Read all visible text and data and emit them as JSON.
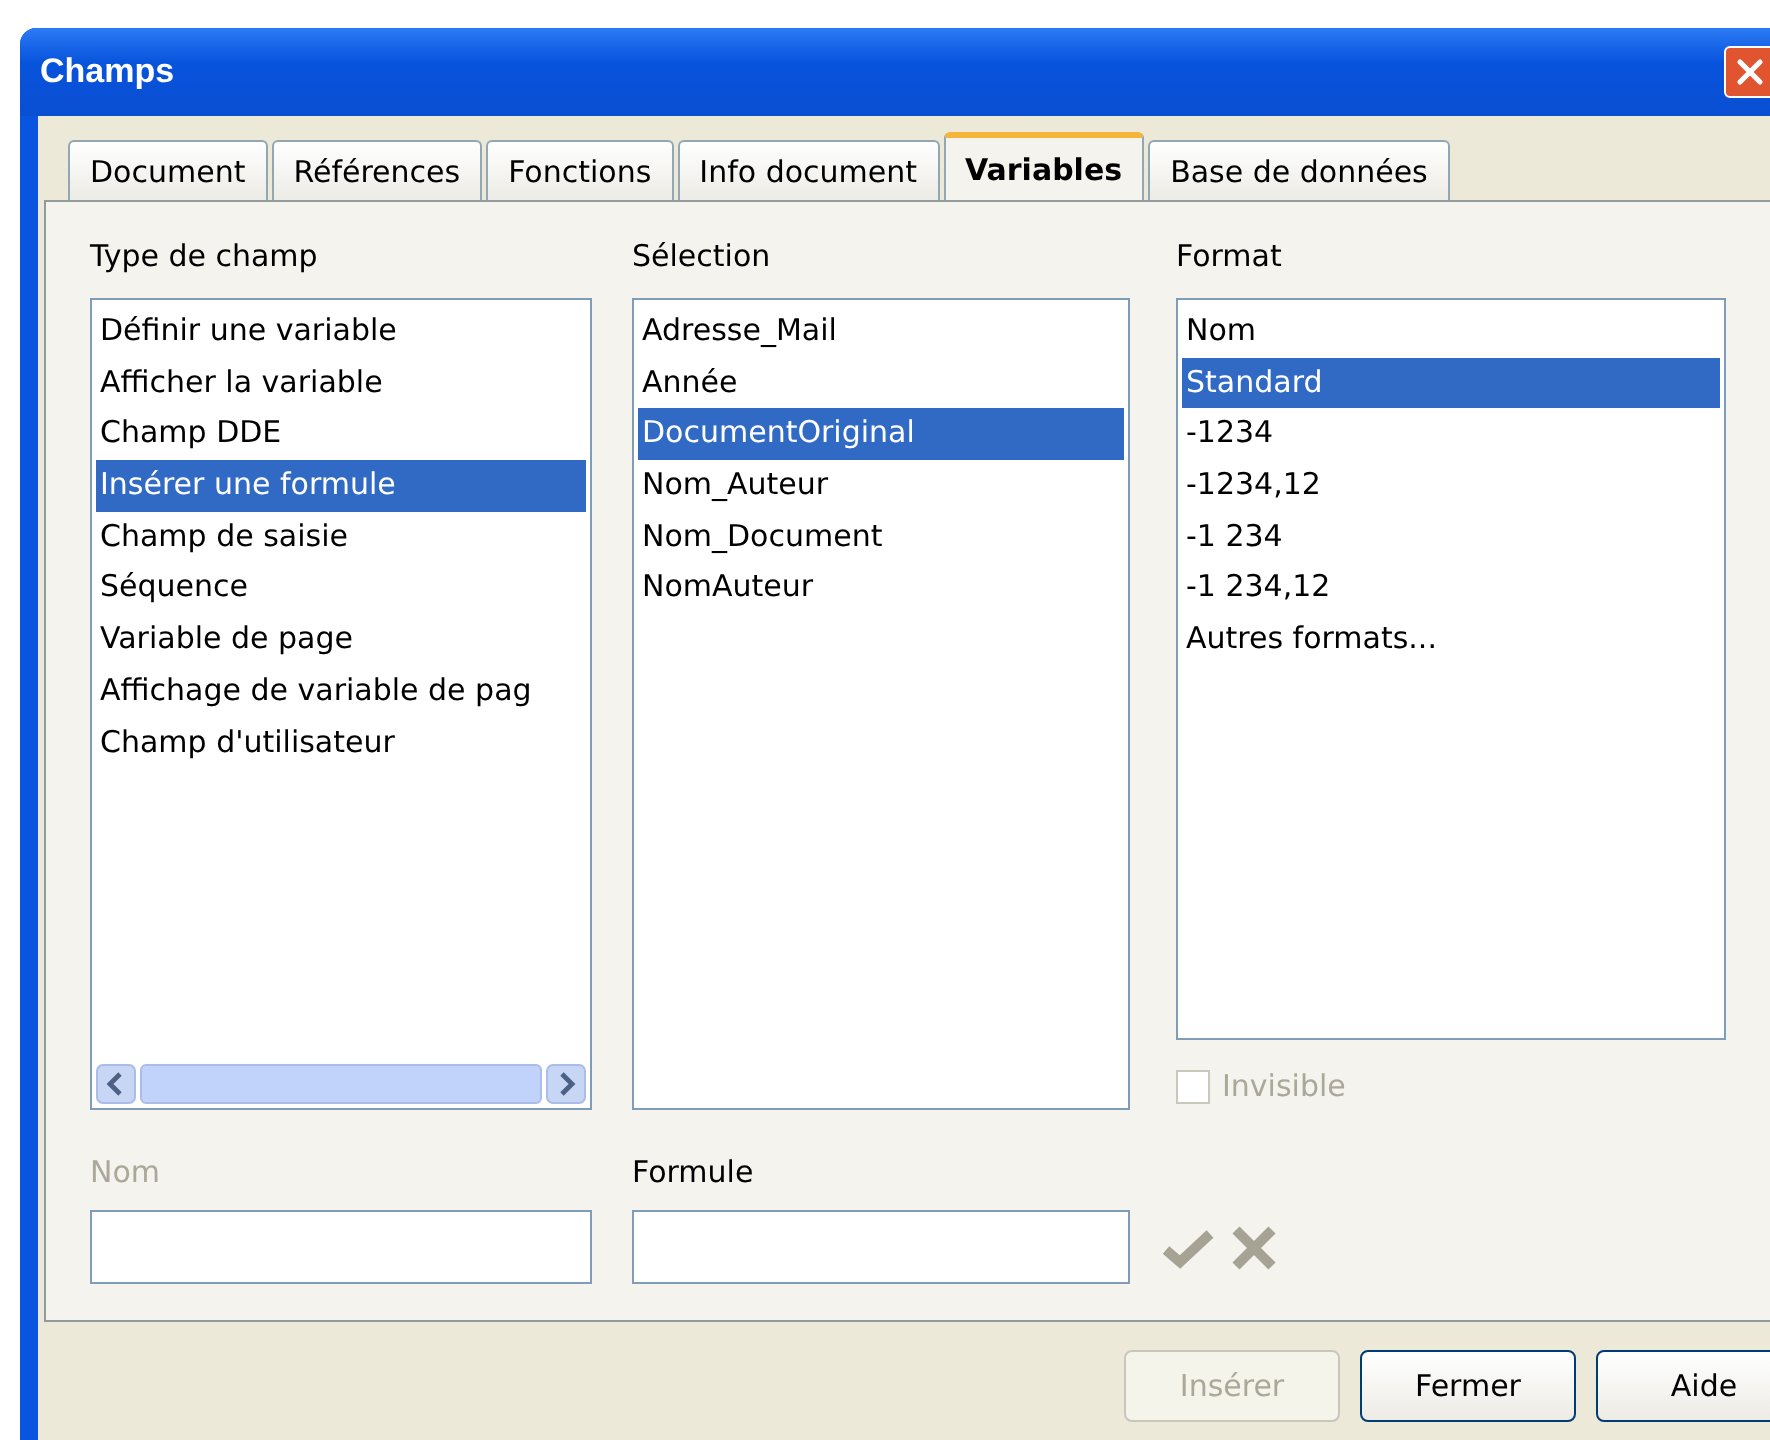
{
  "window": {
    "title": "Champs"
  },
  "tabs": [
    {
      "label": "Document",
      "selected": false
    },
    {
      "label": "Références",
      "selected": false
    },
    {
      "label": "Fonctions",
      "selected": false
    },
    {
      "label": "Info document",
      "selected": false
    },
    {
      "label": "Variables",
      "selected": true
    },
    {
      "label": "Base de données",
      "selected": false
    }
  ],
  "type_de_champ": {
    "label": "Type de champ",
    "items": [
      {
        "label": "Définir une variable",
        "selected": false
      },
      {
        "label": "Afficher la variable",
        "selected": false
      },
      {
        "label": "Champ DDE",
        "selected": false
      },
      {
        "label": "Insérer une formule",
        "selected": true
      },
      {
        "label": "Champ de saisie",
        "selected": false
      },
      {
        "label": "Séquence",
        "selected": false
      },
      {
        "label": "Variable de page",
        "selected": false
      },
      {
        "label": "Affichage de variable de pag",
        "selected": false
      },
      {
        "label": "Champ d'utilisateur",
        "selected": false
      }
    ]
  },
  "selection": {
    "label": "Sélection",
    "items": [
      {
        "label": "Adresse_Mail",
        "selected": false
      },
      {
        "label": "Année",
        "selected": false
      },
      {
        "label": "DocumentOriginal",
        "selected": true
      },
      {
        "label": "Nom_Auteur",
        "selected": false
      },
      {
        "label": "Nom_Document",
        "selected": false
      },
      {
        "label": "NomAuteur",
        "selected": false
      }
    ]
  },
  "format": {
    "label": "Format",
    "items": [
      {
        "label": "Nom",
        "selected": false
      },
      {
        "label": "Standard",
        "selected": true
      },
      {
        "label": "-1234",
        "selected": false
      },
      {
        "label": "-1234,12",
        "selected": false
      },
      {
        "label": "-1 234",
        "selected": false
      },
      {
        "label": "-1 234,12",
        "selected": false
      },
      {
        "label": "Autres formats...",
        "selected": false
      }
    ]
  },
  "invisible": {
    "label": "Invisible",
    "checked": false,
    "disabled": true
  },
  "nom": {
    "label": "Nom",
    "disabled": true
  },
  "formule": {
    "label": "Formule",
    "disabled": false
  },
  "buttons": [
    {
      "label": "Insérer",
      "disabled": true
    },
    {
      "label": "Fermer",
      "disabled": false
    },
    {
      "label": "Aide",
      "disabled": false
    }
  ]
}
